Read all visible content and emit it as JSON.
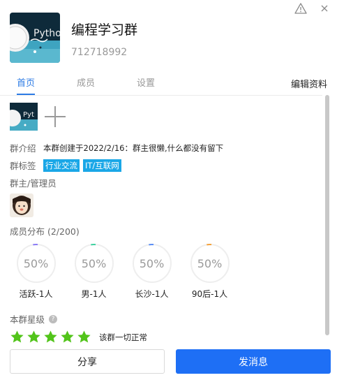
{
  "group": {
    "name": "编程学习群",
    "id": "712718992",
    "avatar_text": "Pytho"
  },
  "tabs": [
    {
      "label": "首页",
      "active": true
    },
    {
      "label": "成员",
      "active": false
    },
    {
      "label": "设置",
      "active": false
    }
  ],
  "edit_label": "编辑资料",
  "photos": {
    "thumb_text": "Pyt"
  },
  "intro": {
    "label": "群介绍",
    "text": "本群创建于2022/2/16：群主很懒,什么都没有留下"
  },
  "tags": {
    "label": "群标签",
    "items": [
      "行业交流",
      "IT/互联网"
    ]
  },
  "admins": {
    "title": "群主/管理员"
  },
  "distribution": {
    "title": "成员分布  (2/200)",
    "items": [
      {
        "percent": "50%",
        "label": "活跃-1人",
        "color": "#8b7cf6",
        "fraction": 0.5
      },
      {
        "percent": "50%",
        "label": "男-1人",
        "color": "#3fd1a0",
        "fraction": 0.5
      },
      {
        "percent": "50%",
        "label": "长沙-1人",
        "color": "#5b8ef5",
        "fraction": 0.5
      },
      {
        "percent": "50%",
        "label": "90后-1人",
        "color": "#f5a23a",
        "fraction": 0.5
      }
    ]
  },
  "stars": {
    "title": "本群星级",
    "count": 5,
    "color": "#52c41a",
    "status": "该群一切正常"
  },
  "buttons": {
    "share": "分享",
    "send": "发消息"
  },
  "colors": {
    "accent": "#2c7be5",
    "primary_button": "#1e6ff5",
    "tag": "#1aa7e7"
  }
}
